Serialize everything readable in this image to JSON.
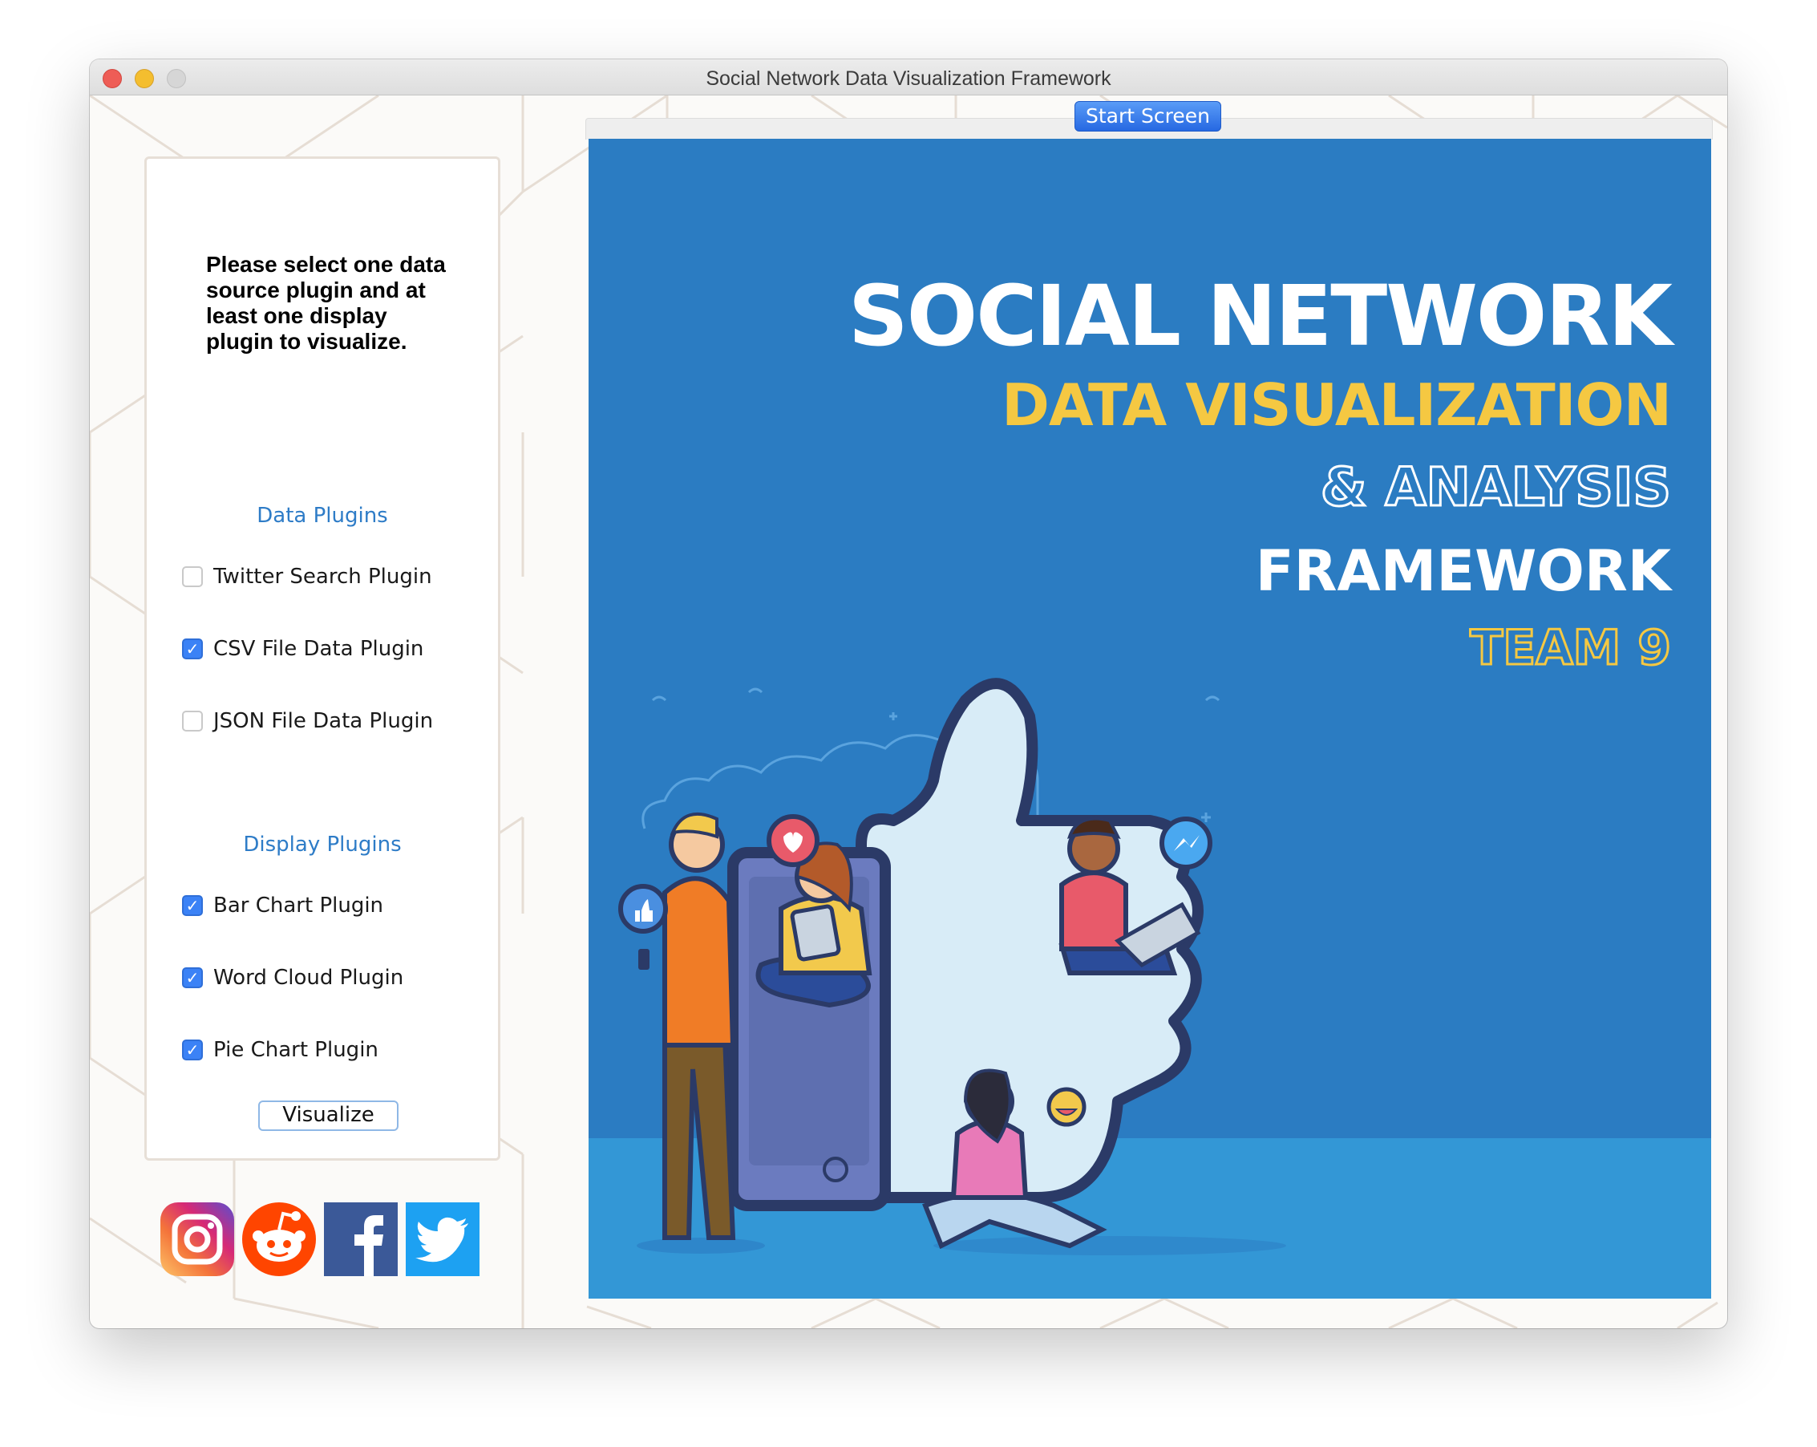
{
  "window": {
    "title": "Social Network Data Visualization Framework"
  },
  "left_panel": {
    "instructions": "Please select one data source plugin and at least one display plugin to visualize.",
    "data_plugins_header": "Data Plugins",
    "data_plugins": [
      {
        "label": "Twitter Search Plugin",
        "checked": false
      },
      {
        "label": "CSV File Data Plugin",
        "checked": true
      },
      {
        "label": "JSON File Data Plugin",
        "checked": false
      }
    ],
    "display_plugins_header": "Display Plugins",
    "display_plugins": [
      {
        "label": "Bar Chart Plugin",
        "checked": true
      },
      {
        "label": "Word Cloud Plugin",
        "checked": true
      },
      {
        "label": "Pie Chart Plugin",
        "checked": true
      }
    ],
    "visualize_button": "Visualize",
    "social_icons": [
      "instagram-icon",
      "reddit-icon",
      "facebook-icon",
      "twitter-icon"
    ]
  },
  "main": {
    "start_screen_button": "Start Screen",
    "poster": {
      "line1": "SOCIAL NETWORK",
      "line2": "DATA VISUALIZATION",
      "line3": "& ANALYSIS",
      "line4": "FRAMEWORK",
      "line5": "TEAM 9"
    }
  },
  "colors": {
    "accent_blue": "#3b82f6",
    "section_header": "#2e7cc7",
    "poster_blue": "#2b7cc2",
    "poster_yellow": "#f5c842"
  }
}
